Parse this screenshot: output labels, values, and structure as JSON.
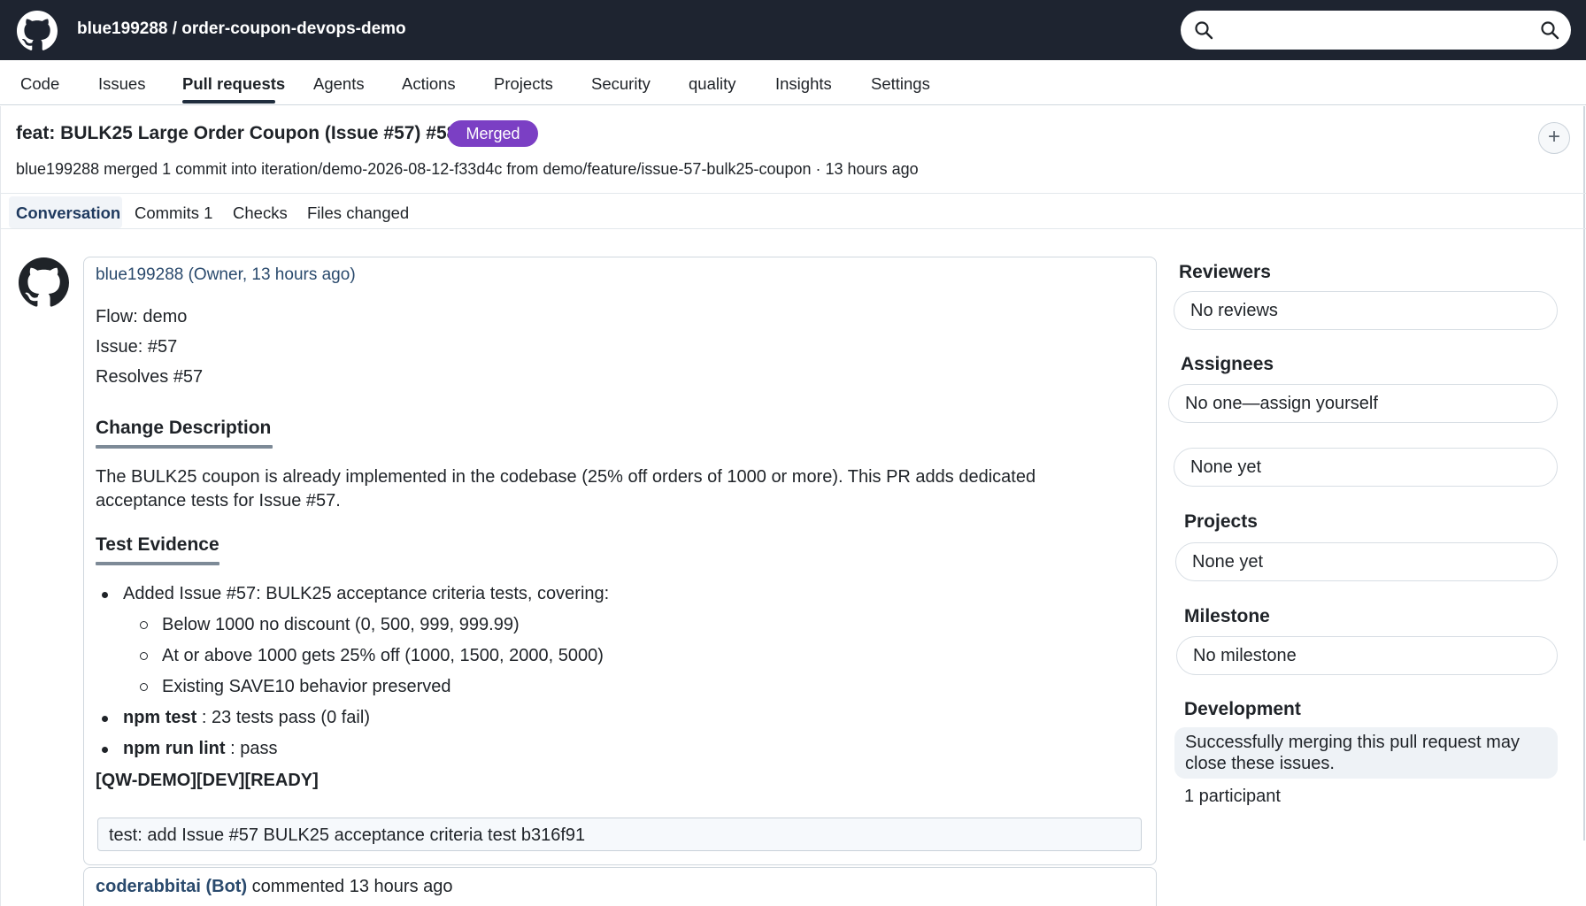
{
  "header": {
    "repo": "blue199288 / order-coupon-devops-demo",
    "logo_icon": "github-icon",
    "search_icon": "search-icon"
  },
  "repo_nav": {
    "items": [
      "Code",
      "Issues",
      "Pull requests",
      "Agents",
      "Actions",
      "Projects",
      "Security",
      "quality",
      "Insights",
      "Settings"
    ],
    "active": "Pull requests"
  },
  "pr": {
    "title": "feat: BULK25 Large Order Coupon (Issue #57) #58",
    "status": "Merged",
    "status_color": "#7b3fc4",
    "subtitle": "blue199288 merged 1 commit into iteration/demo-2026-08-12-f33d4c from demo/feature/issue-57-bulk25-coupon · 13 hours ago",
    "add_label": "+"
  },
  "tabs": {
    "conversation": "Conversation",
    "commits": "Commits 1",
    "checks": "Checks",
    "files": "Files changed"
  },
  "comment": {
    "author": "blue199288 (Owner, 13 hours ago)",
    "lines": [
      "Flow: demo",
      "Issue: #57",
      "Resolves #57"
    ],
    "change_heading": "Change Description",
    "change_text": "The BULK25 coupon is already implemented in the codebase (25% off orders of 1000 or more). This PR adds dedicated acceptance tests for Issue #57.",
    "test_heading": "Test Evidence",
    "bullet1": "Added Issue #57: BULK25 acceptance criteria tests, covering:",
    "sub1": "Below 1000 no discount (0, 500, 999, 999.99)",
    "sub2": "At or above 1000 gets 25% off (1000, 1500, 2000, 5000)",
    "sub3": "Existing SAVE10 behavior preserved",
    "bullet2_bold": "npm test",
    "bullet2_rest": " : 23 tests pass (0 fail)",
    "bullet3_bold": "npm run lint",
    "bullet3_rest": " : pass",
    "tag_line": "[QW-DEMO][DEV][READY]",
    "commit": "test: add Issue #57 BULK25 acceptance criteria test b316f91"
  },
  "bot_comment": {
    "author": "coderabbitai (Bot)",
    "text": " commented 13 hours ago"
  },
  "sidebar": {
    "reviewers_heading": "Reviewers",
    "reviewers_value": "No reviews",
    "assignees_heading": "Assignees",
    "assignees_value": "No one—assign yourself",
    "labels_value": "None yet",
    "projects_heading": "Projects",
    "projects_value": "None yet",
    "milestone_heading": "Milestone",
    "milestone_value": "No milestone",
    "development_heading": "Development",
    "development_text": "Successfully merging this pull request may close these issues.",
    "participants": "1 participant"
  }
}
